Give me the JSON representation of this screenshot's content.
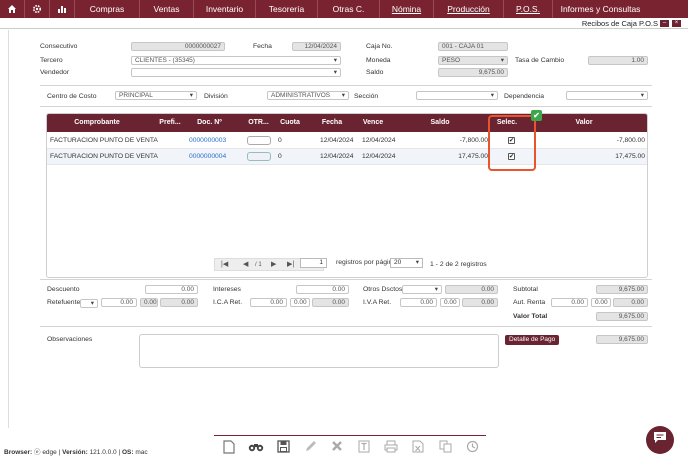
{
  "nav": {
    "icons": [
      "home-icon",
      "gear-icon",
      "bar-chart-icon"
    ],
    "menu": [
      "Compras",
      "Ventas",
      "Inventario",
      "Tesorería",
      "Otras C.",
      "Nómina",
      "Producción",
      "P.O.S.",
      "Informes y Consultas"
    ]
  },
  "window": {
    "title": "Recibos de Caja P.O.S",
    "min": "–",
    "close": "×"
  },
  "header": {
    "consecutivo_label": "Consecutivo",
    "consecutivo": "0000000027",
    "fecha_label": "Fecha",
    "fecha": "12/04/2024",
    "caja_label": "Caja No.",
    "caja": "001 - CAJA 01",
    "tercero_label": "Tercero",
    "tercero": "CLIENTES - (35345)",
    "moneda_label": "Moneda",
    "moneda": "PESO",
    "tasa_label": "Tasa de Cambio",
    "tasa": "1.00",
    "vendedor_label": "Vendedor",
    "vendedor": "",
    "saldo_label": "Saldo",
    "saldo": "9,675.00"
  },
  "filters": {
    "centro_label": "Centro de Costo",
    "centro": "PRINCIPAL",
    "division_label": "División",
    "division": "ADMINISTRATIVOS",
    "seccion_label": "Sección",
    "seccion": "",
    "dependencia_label": "Dependencia",
    "dependencia": ""
  },
  "grid": {
    "columns": [
      "Comprobante",
      "Prefi...",
      "Doc. Nº",
      "OTR...",
      "Cuota",
      "Fecha",
      "Vence",
      "Saldo",
      "Selec.",
      "Valor"
    ],
    "rows": [
      {
        "comprobante": "FACTURACION PUNTO DE VENTA",
        "doc": "0000000003",
        "cuota": "0",
        "fecha": "12/04/2024",
        "vence": "12/04/2024",
        "saldo": "-7,800.00",
        "valor": "-7,800.00",
        "check": "✔"
      },
      {
        "comprobante": "FACTURACION PUNTO DE VENTA",
        "doc": "0000000004",
        "cuota": "0",
        "fecha": "12/04/2024",
        "vence": "12/04/2024",
        "saldo": "17,475.00",
        "valor": "17,475.00",
        "check": "✔"
      }
    ],
    "selected_badge": "✔"
  },
  "pager": {
    "first": "|◀",
    "prev": "◀",
    "slash": "/ 1",
    "next": "▶",
    "last": "▶|",
    "page": "1",
    "per_page_label": "registros por página",
    "per_page": "20",
    "summary": "1 - 2 de 2 registros"
  },
  "totals": {
    "descuento_label": "Descuento",
    "descuento": "0.00",
    "intereses_label": "Intereses",
    "intereses": "0.00",
    "otros_label": "Otros Dsctos:",
    "otros": "0.00",
    "subtotal_label": "Subtotal",
    "subtotal": "9,675.00",
    "retefuente_label": "Retefuente.",
    "rf1": "0.00",
    "rf2": "0.00",
    "rf3": "0.00",
    "ica_label": "I.C.A Ret.",
    "ica1": "0.00",
    "ica2": "0.00",
    "ica3": "0.00",
    "iva_label": "I.V.A Ret.",
    "iva1": "0.00",
    "iva2": "0.00",
    "iva3": "0.00",
    "autrenta_label": "Aut. Renta",
    "ar1": "0.00",
    "ar2": "0.00",
    "ar3": "0.00",
    "valortotal_label": "Valor Total",
    "valortotal": "9,675.00"
  },
  "obs": {
    "label": "Observaciones",
    "detalle": "Detalle de Pago",
    "detalle_value": "9,675.00"
  },
  "toolbar": [
    "new-doc-icon",
    "binoculars-icon",
    "save-icon",
    "edit-icon",
    "delete-icon",
    "text-icon",
    "print-icon",
    "excel-icon",
    "copy-icon",
    "history-icon"
  ],
  "footer": {
    "browser_label": "Browser:",
    "browser": "edge",
    "version_label": "Versión:",
    "version": "121.0.0.0",
    "os_label": "OS:",
    "os": "mac"
  },
  "chat": {
    "icon": "chat-icon"
  }
}
